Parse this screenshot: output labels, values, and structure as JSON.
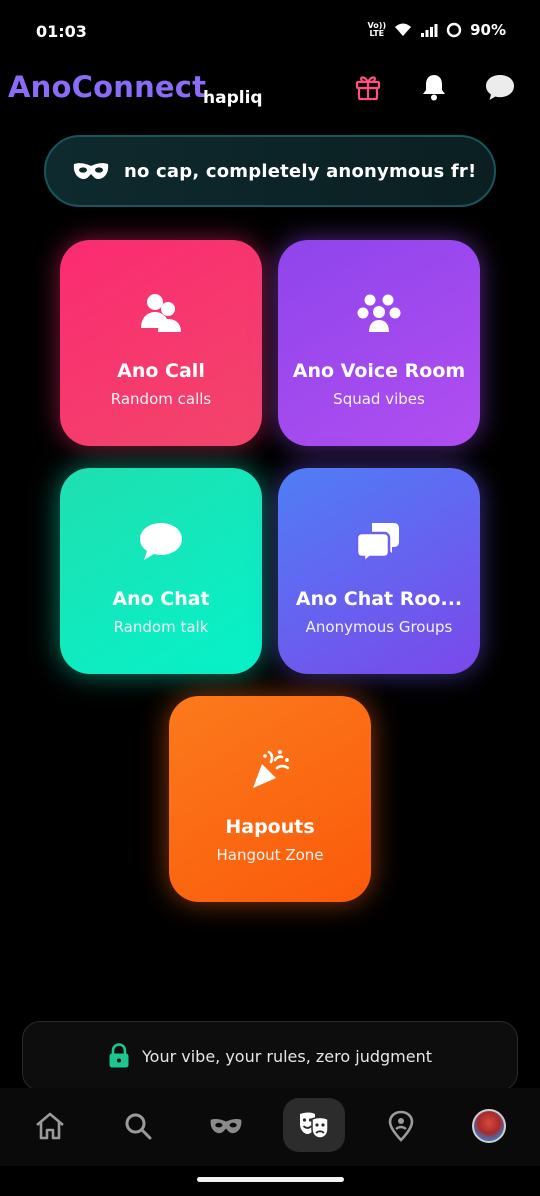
{
  "status_bar": {
    "time": "01:03",
    "network_label_top": "Vo))",
    "network_label_bottom": "LTE",
    "battery": "90%"
  },
  "header": {
    "app_name": "AnoConnect",
    "brand_sub": "hapliq",
    "icons": [
      "gift-icon",
      "bell-icon",
      "chat-bubble-icon"
    ]
  },
  "banner": {
    "icon": "mask-icon",
    "text": "no cap, completely anonymous fr!"
  },
  "cards": [
    {
      "title": "Ano Call",
      "subtitle": "Random calls",
      "icon": "users-icon",
      "color": "#fb2b72"
    },
    {
      "title": "Ano Voice Room",
      "subtitle": "Squad vibes",
      "icon": "group-icon",
      "color": "#9d4aef"
    },
    {
      "title": "Ano Chat",
      "subtitle": "Random talk",
      "icon": "speech-bubble-icon",
      "color": "#10ebbe"
    },
    {
      "title": "Ano Chat Roo...",
      "subtitle": "Anonymous Groups",
      "icon": "chat-bubbles-icon",
      "color": "#6563ef"
    },
    {
      "title": "Hapouts",
      "subtitle": "Hangout Zone",
      "icon": "party-popper-icon",
      "color": "#fb6a12"
    }
  ],
  "info_bar": {
    "icon": "lock-icon",
    "text": "Your vibe, your rules, zero judgment"
  },
  "bottom_nav": {
    "items": [
      "home-icon",
      "search-icon",
      "mask-icon",
      "theater-masks-icon",
      "location-pin-icon",
      "avatar"
    ],
    "active_index": 3
  },
  "colors": {
    "brand_purple": "#8b6cf6",
    "gift_pink": "#ff4f7b",
    "lock_green": "#1fc58e"
  }
}
